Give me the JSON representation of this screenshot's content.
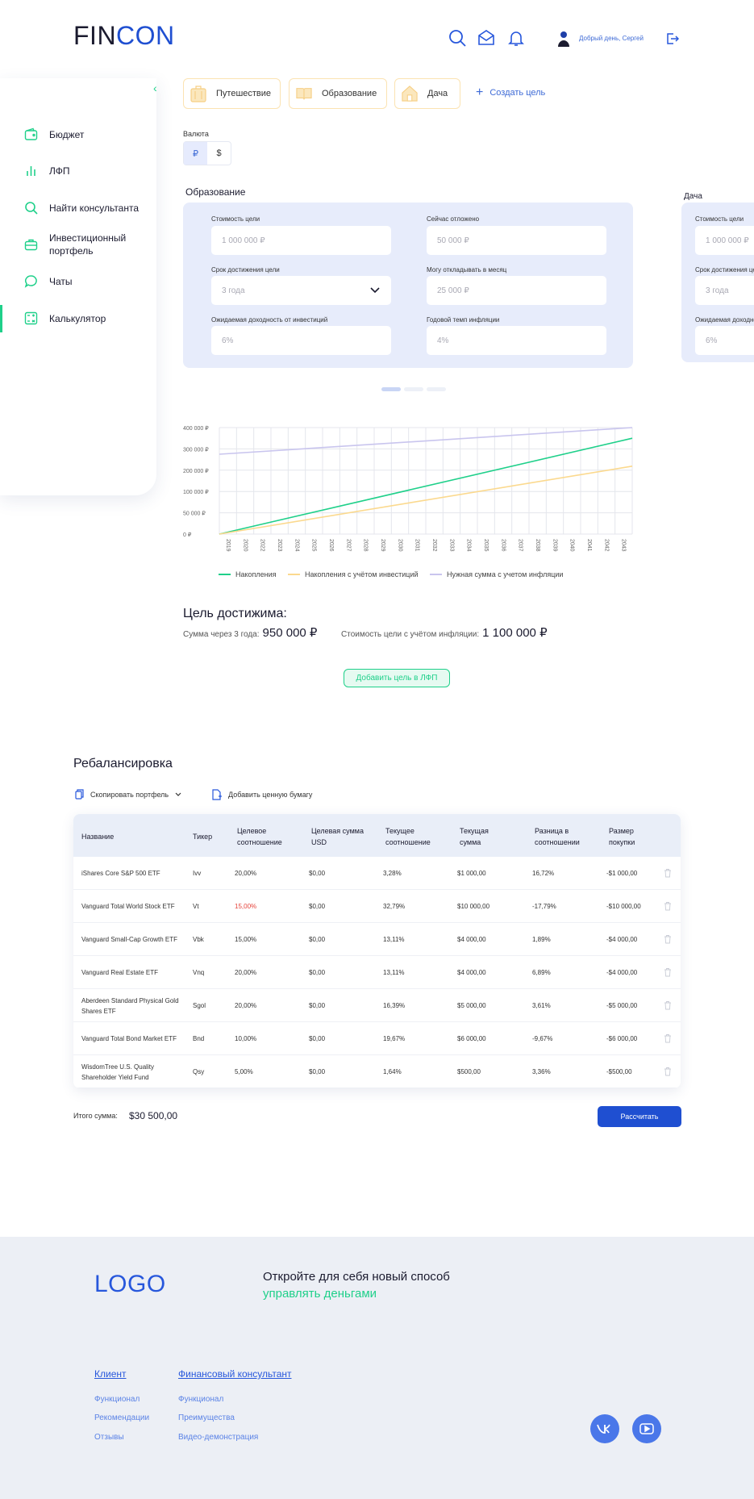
{
  "header": {
    "logo_part1": "FIN",
    "logo_part2": "CON",
    "greeting": "Добрый день, Сергей"
  },
  "sidebar": {
    "items": [
      {
        "label": "Бюджет",
        "icon": "wallet-icon"
      },
      {
        "label": "ЛФП",
        "icon": "bar-chart-icon"
      },
      {
        "label": "Найти консультанта",
        "icon": "search-icon"
      },
      {
        "label": "Инвестиционный портфель",
        "icon": "briefcase-icon"
      },
      {
        "label": "Чаты",
        "icon": "chat-icon"
      },
      {
        "label": "Калькулятор",
        "icon": "calculator-icon",
        "active": true
      }
    ]
  },
  "goals": {
    "tabs": [
      {
        "label": "Путешествие",
        "icon": "suitcase-icon"
      },
      {
        "label": "Образование",
        "icon": "book-icon"
      },
      {
        "label": "Дача",
        "icon": "house-icon"
      }
    ],
    "create_label": "Создать цель"
  },
  "currency": {
    "label": "Валюта",
    "options": [
      "₽",
      "$"
    ],
    "selected": "₽"
  },
  "goal_form": {
    "title": "Образование",
    "fields": {
      "cost_label": "Стоимость цели",
      "cost_value": "1 000 000 ₽",
      "saved_label": "Сейчас отложено",
      "saved_value": "50 000 ₽",
      "term_label": "Срок достижения цели",
      "term_value": "3 года",
      "monthly_label": "Могу откладывать в месяц",
      "monthly_value": "25 000 ₽",
      "yield_label": "Ожидаемая доходность от инвестиций",
      "yield_value": "6%",
      "inflation_label": "Годовой темп инфляции",
      "inflation_value": "4%"
    }
  },
  "goal_form_2": {
    "title": "Дача",
    "cost_label": "Стоимость цели",
    "cost_value": "1 000 000 ₽",
    "term_label": "Срок достижения цели",
    "term_value": "3 года",
    "yield_label": "Ожидаемая доходность",
    "yield_value": "6%"
  },
  "chart_data": {
    "type": "line",
    "x": [
      "2019",
      "2020",
      "2022",
      "2023",
      "2024",
      "2025",
      "2026",
      "2027",
      "2028",
      "2029",
      "2030",
      "2031",
      "2032",
      "2033",
      "2034",
      "2035",
      "2036",
      "2037",
      "2038",
      "2039",
      "2040",
      "2041",
      "2042",
      "2043"
    ],
    "yticks": [
      "400 000 ₽",
      "300 000 ₽",
      "200 000 ₽",
      "100 000 ₽",
      "50 000 ₽",
      "0 ₽"
    ],
    "series": [
      {
        "name": "Накопления",
        "color": "#1fd08a",
        "start": 0,
        "end": 360000
      },
      {
        "name": "Накопления с учётом инвестиций",
        "color": "#fbd98e",
        "start": 0,
        "end": 255000
      },
      {
        "name": "Нужная сумма с учетом инфляции",
        "color": "#c9c5ee",
        "start": 300000,
        "end": 400000
      }
    ]
  },
  "result": {
    "heading": "Цель достижима:",
    "sum_label": "Сумма через 3 года:",
    "sum_value": "950 000 ₽",
    "cost_label": "Стоимость цели с учётом инфляции:",
    "cost_value": "1 100 000 ₽",
    "add_button": "Добавить цель в ЛФП"
  },
  "rebalancing": {
    "title": "Ребалансировка",
    "copy_label": "Скопировать портфель",
    "add_label": "Добавить ценную бумагу",
    "columns": [
      "Название",
      "Тикер",
      "Целевое соотношение",
      "Целевая сумма USD",
      "Текущее соотношение",
      "Текущая сумма",
      "Разница в соотношении",
      "Размер покупки"
    ],
    "rows": [
      {
        "name": "iShares Core S&P 500 ETF",
        "ticker": "Ivv",
        "target": "20,00%",
        "target_usd": "$0,00",
        "current": "3,28%",
        "current_sum": "$1 000,00",
        "diff": "16,72%",
        "buy": "-$1 000,00"
      },
      {
        "name": "Vanguard Total World Stock ETF",
        "ticker": "Vt",
        "target": "15,00%",
        "target_usd": "$0,00",
        "current": "32,79%",
        "current_sum": "$10 000,00",
        "diff": "-17,79%",
        "buy": "-$10 000,00"
      },
      {
        "name": "Vanguard Small-Cap Growth ETF",
        "ticker": "Vbk",
        "target": "15,00%",
        "target_usd": "$0,00",
        "current": "13,11%",
        "current_sum": "$4 000,00",
        "diff": "1,89%",
        "buy": "-$4 000,00"
      },
      {
        "name": "Vanguard Real Estate ETF",
        "ticker": "Vnq",
        "target": "20,00%",
        "target_usd": "$0,00",
        "current": "13,11%",
        "current_sum": "$4 000,00",
        "diff": "6,89%",
        "buy": "-$4 000,00"
      },
      {
        "name": "Aberdeen Standard Physical Gold Shares ETF",
        "ticker": "Sgol",
        "target": "20,00%",
        "target_usd": "$0,00",
        "current": "16,39%",
        "current_sum": "$5 000,00",
        "diff": "3,61%",
        "buy": "-$5 000,00"
      },
      {
        "name": "Vanguard Total Bond Market ETF",
        "ticker": "Bnd",
        "target": "10,00%",
        "target_usd": "$0,00",
        "current": "19,67%",
        "current_sum": "$6 000,00",
        "diff": "-9,67%",
        "buy": "-$6 000,00"
      },
      {
        "name": "WisdomTree U.S. Quality Shareholder Yield Fund",
        "ticker": "Qsy",
        "target": "5,00%",
        "target_usd": "$0,00",
        "current": "1,64%",
        "current_sum": "$500,00",
        "diff": "3,36%",
        "buy": "-$500,00"
      }
    ],
    "total_label": "Итого сумма:",
    "total_value": "$30 500,00",
    "calc_button": "Рассчитать"
  },
  "footer": {
    "logo": "LOGO",
    "tagline1": "Откройте для себя новый способ",
    "tagline2": "управлять деньгами",
    "col1_title": "Клиент",
    "col1_links": [
      "Функционал",
      "Рекомендации",
      "Отзывы"
    ],
    "col2_title": "Финансовый консультант",
    "col2_links": [
      "Функционал",
      "Преимущества",
      "Видео-демонстрация"
    ],
    "social": [
      "vk-icon",
      "youtube-icon"
    ]
  }
}
